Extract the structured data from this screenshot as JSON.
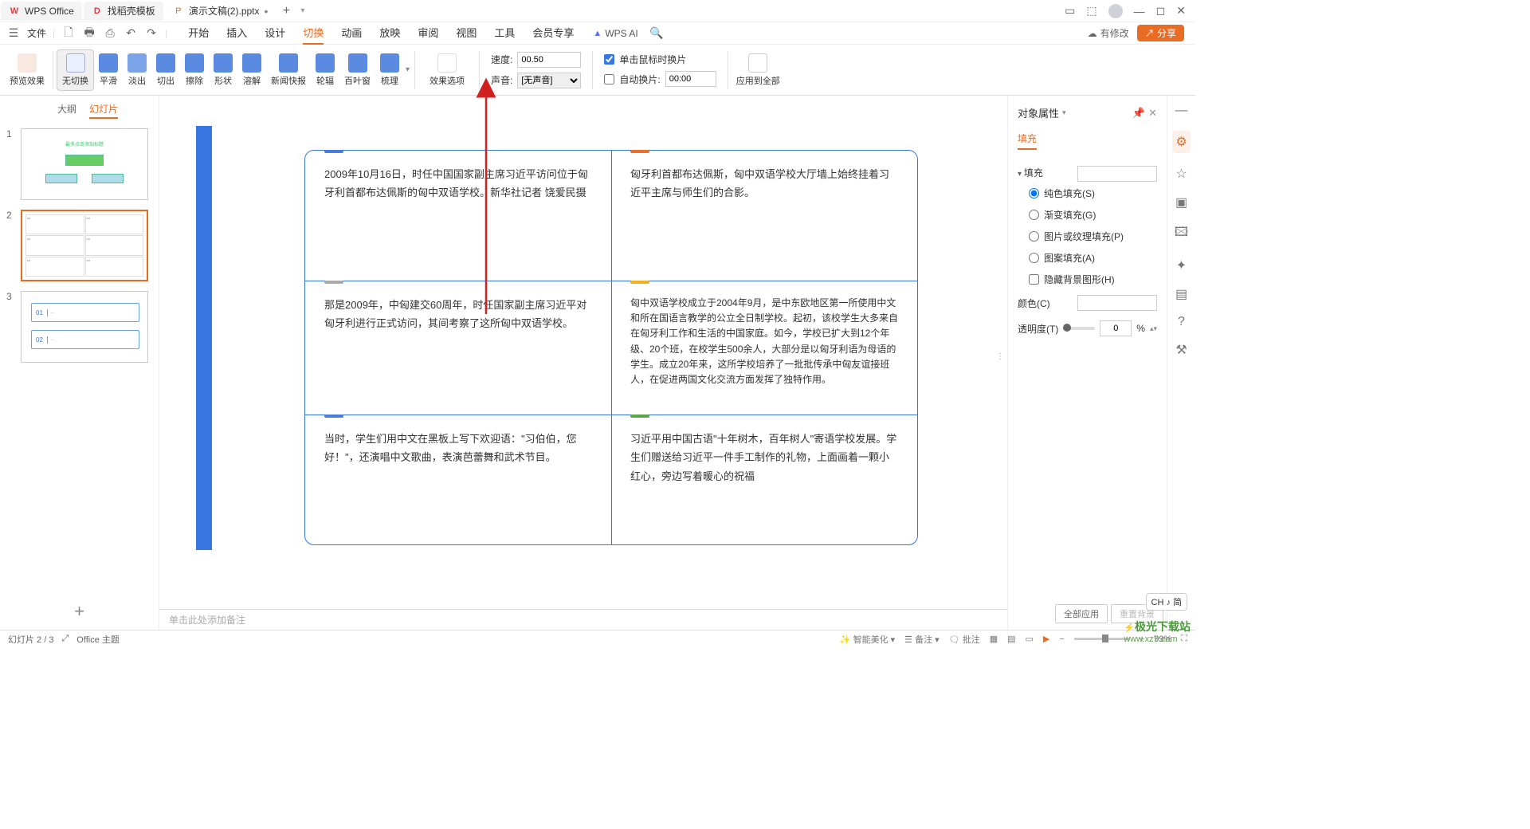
{
  "titlebar": {
    "app": "WPS Office",
    "tab1": "找稻壳模板",
    "tab2": "演示文稿(2).pptx",
    "plus": "+",
    "drop": "▾"
  },
  "menubar": {
    "file": "文件",
    "tabs": [
      "开始",
      "插入",
      "设计",
      "切换",
      "动画",
      "放映",
      "审阅",
      "视图",
      "工具",
      "会员专享"
    ],
    "active_index": 3,
    "wpsai": "WPS AI",
    "modify": "有修改",
    "share": "分享"
  },
  "ribbon": {
    "preview": "预览效果",
    "transitions": [
      "无切换",
      "平滑",
      "淡出",
      "切出",
      "擦除",
      "形状",
      "溶解",
      "新闻快报",
      "轮辐",
      "百叶窗",
      "梳理"
    ],
    "selected_index": 0,
    "effect_options": "效果选项",
    "speed_label": "速度:",
    "speed_value": "00.50",
    "sound_label": "声音:",
    "sound_value": "[无声音]",
    "click_label": "单击鼠标时换片",
    "click_checked": true,
    "auto_label": "自动换片:",
    "auto_checked": false,
    "auto_value": "00:00",
    "apply_all": "应用到全部"
  },
  "slidepanel": {
    "tab_outline": "大纲",
    "tab_slides": "幻灯片",
    "thumbs": [
      1,
      2,
      3
    ],
    "thumb1_title": "最多点击添加标题"
  },
  "slide": {
    "c1": "2009年10月16日，时任中国国家副主席习近平访问位于匈牙利首都布达佩斯的匈中双语学校。新华社记者 饶爱民摄",
    "c2": "匈牙利首都布达佩斯，匈中双语学校大厅墙上始终挂着习近平主席与师生们的合影。",
    "c3": "那是2009年，中匈建交60周年，时任国家副主席习近平对匈牙利进行正式访问，其间考察了这所匈中双语学校。",
    "c4": "匈中双语学校成立于2004年9月，是中东欧地区第一所使用中文和所在国语言教学的公立全日制学校。起初，该校学生大多来自在匈牙利工作和生活的中国家庭。如今，学校已扩大到12个年级、20个班，在校学生500余人，大部分是以匈牙利语为母语的学生。成立20年来，这所学校培养了一批批传承中匈友谊接班人，在促进两国文化交流方面发挥了独特作用。",
    "c5": "当时，学生们用中文在黑板上写下欢迎语：\"习伯伯，您好！\"，还演唱中文歌曲，表演芭蕾舞和武术节目。",
    "c6": "习近平用中国古语\"十年树木，百年树人\"寄语学校发展。学生们赠送给习近平一件手工制作的礼物，上面画着一颗小红心，旁边写着暖心的祝福"
  },
  "notes_placeholder": "单击此处添加备注",
  "prop": {
    "title": "对象属性",
    "sub": "填充",
    "sec_fill": "填充",
    "r1": "纯色填充(S)",
    "r2": "渐变填充(G)",
    "r3": "图片或纹理填充(P)",
    "r4": "图案填充(A)",
    "chk": "隐藏背景图形(H)",
    "color_label": "颜色(C)",
    "opacity_label": "透明度(T)",
    "opacity_val": "0",
    "opacity_unit": "%",
    "apply_all": "全部应用",
    "reset_bg": "重置背景"
  },
  "status": {
    "slide": "幻灯片 2 / 3",
    "theme": "Office 主题",
    "beautify": "智能美化",
    "notes": "备注",
    "comments": "批注",
    "zoom": "99%",
    "ime": "CH ♪ 简"
  },
  "watermark": {
    "brand": "极光下载站",
    "url": "www.xz7.com"
  }
}
